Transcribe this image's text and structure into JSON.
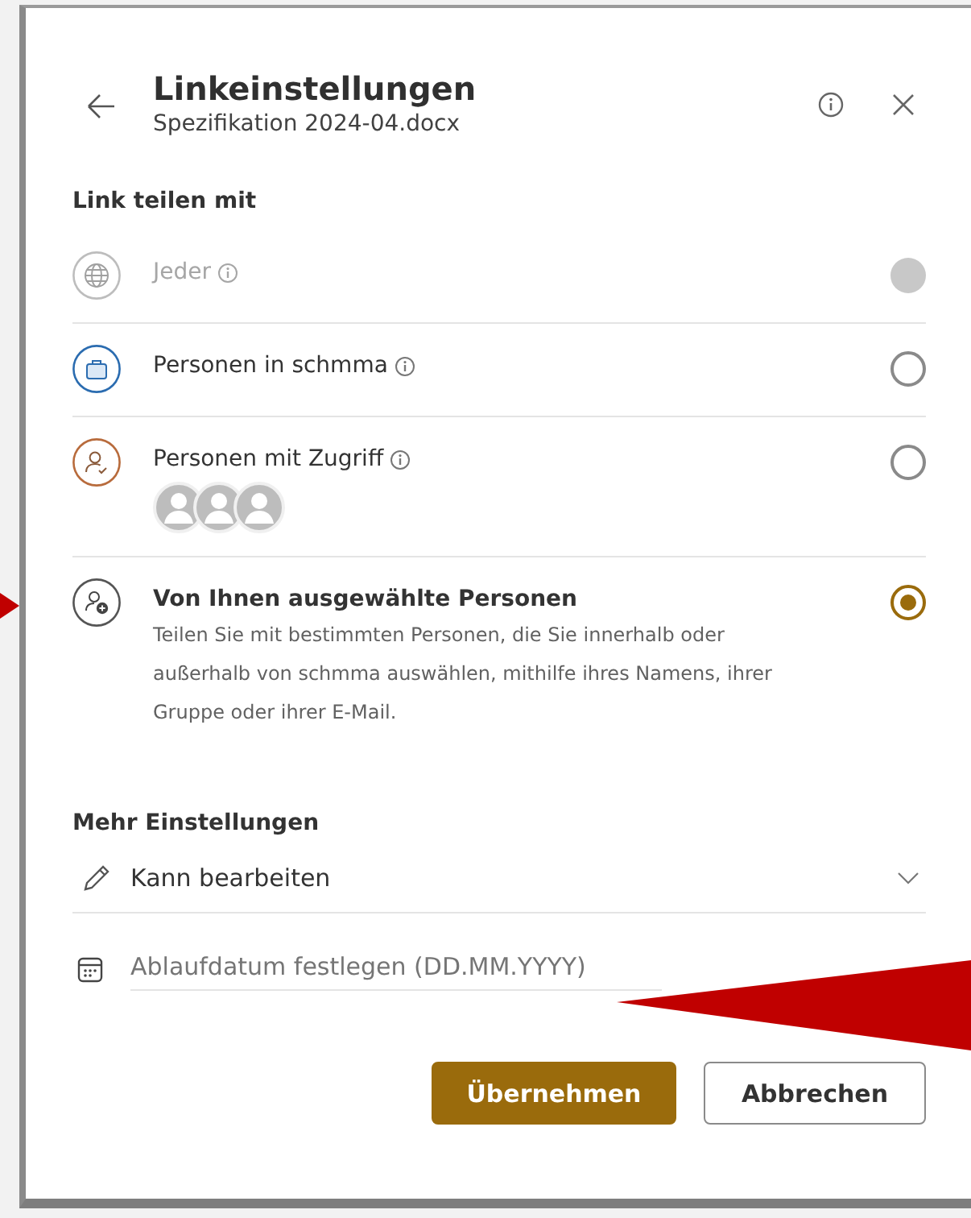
{
  "header": {
    "title": "Linkeinstellungen",
    "subtitle": "Spezifikation 2024-04.docx"
  },
  "share_section": {
    "heading": "Link teilen mit",
    "options": [
      {
        "kind": "globe",
        "label": "Jeder",
        "has_info": true,
        "disabled": true,
        "selected": false
      },
      {
        "kind": "organization",
        "label": "Personen in schmma",
        "has_info": true,
        "disabled": false,
        "selected": false
      },
      {
        "kind": "existing_access",
        "label": "Personen mit Zugriff",
        "has_info": true,
        "disabled": false,
        "selected": false
      },
      {
        "kind": "specific_people",
        "label": "Von Ihnen ausgewählte Personen",
        "description": "Teilen Sie mit bestimmten Personen, die Sie innerhalb oder außerhalb von schmma auswählen, mithilfe ihres Namens, ihrer Gruppe oder ihrer E-Mail.",
        "has_info": false,
        "disabled": false,
        "selected": true
      }
    ]
  },
  "more_settings": {
    "heading": "Mehr Einstellungen",
    "permission": {
      "value": "Kann bearbeiten"
    },
    "expiry": {
      "placeholder": "Ablaufdatum festlegen (DD.MM.YYYY)"
    }
  },
  "buttons": [
    {
      "kind": "primary",
      "label": "Übernehmen"
    },
    {
      "kind": "secondary",
      "label": "Abbrechen"
    }
  ]
}
